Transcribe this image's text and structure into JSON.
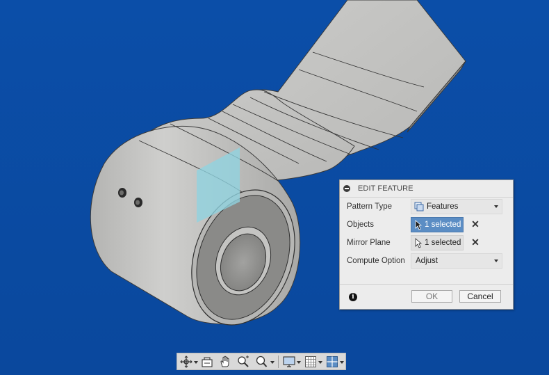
{
  "viewport": {
    "background_color": "#0a4da6",
    "model_color": "#c8c8c6",
    "plane_color": "#8fd3e0"
  },
  "dialog": {
    "title": "EDIT FEATURE",
    "collapse_icon": "minus-circle-icon",
    "rows": {
      "pattern_type": {
        "label": "Pattern Type",
        "value": "Features",
        "icon": "features-icon"
      },
      "objects": {
        "label": "Objects",
        "value": "1 selected",
        "active": true
      },
      "mirror_plane": {
        "label": "Mirror Plane",
        "value": "1 selected",
        "active": false
      },
      "compute_option": {
        "label": "Compute Option",
        "value": "Adjust"
      }
    },
    "clear_glyph": "✕",
    "info_glyph": "i",
    "ok_label": "OK",
    "cancel_label": "Cancel",
    "active_color": "#5b8dc4"
  },
  "toolbar": {
    "icons": [
      "orbit-icon",
      "look-at-icon",
      "pan-icon",
      "zoom-icon",
      "fit-icon",
      "display-settings-icon",
      "grid-icon",
      "viewports-icon"
    ]
  }
}
